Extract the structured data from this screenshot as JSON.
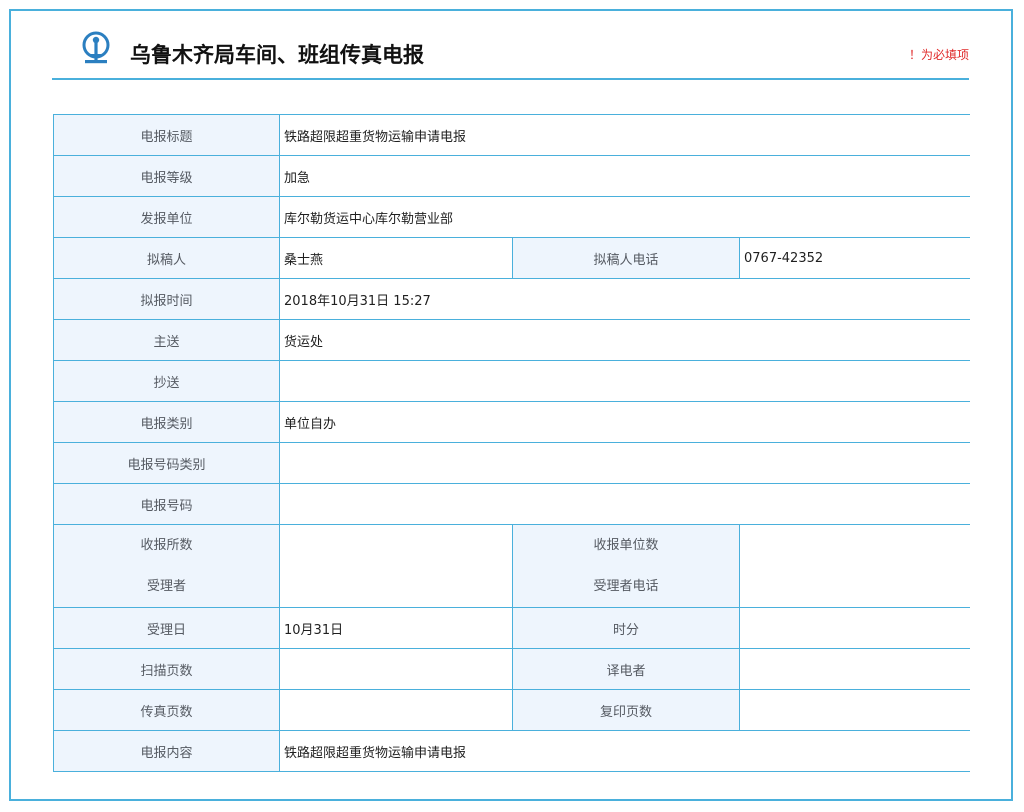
{
  "header": {
    "title": "乌鲁木齐局车间、班组传真电报",
    "required_note": "！为必填项",
    "logo_icon": "railway-logo-icon"
  },
  "colors": {
    "accent": "#4ab0dc",
    "label_bg": "#eef5fd",
    "required": "#e02a2a"
  },
  "form": {
    "title_label": "电报标题",
    "title_value": "铁路超限超重货物运输申请电报",
    "level_label": "电报等级",
    "level_value": "加急",
    "sender_unit_label": "发报单位",
    "sender_unit_value": "库尔勒货运中心库尔勒营业部",
    "drafter_label": "拟稿人",
    "drafter_value": "桑士燕",
    "drafter_phone_label": "拟稿人电话",
    "drafter_phone_value": "0767-42352",
    "draft_time_label": "拟报时间",
    "draft_time_value": "2018年10月31日 15:27",
    "main_to_label": "主送",
    "main_to_value": "货运处",
    "cc_label": "抄送",
    "cc_value": "",
    "category_label": "电报类别",
    "category_value": "单位自办",
    "number_category_label": "电报号码类别",
    "number_category_value": "",
    "number_label": "电报号码",
    "number_value": "",
    "receive_count_label": "收报所数",
    "receive_count_value": "",
    "receive_unit_count_label": "收报单位数",
    "receive_unit_count_value": "",
    "handler_label": "受理者",
    "handler_value": "",
    "handler_phone_label": "受理者电话",
    "handler_phone_value": "",
    "accept_date_label": "受理日",
    "accept_date_value": "10月31日",
    "time_label": "时分",
    "time_value": "",
    "scan_pages_label": "扫描页数",
    "scan_pages_value": "",
    "translator_label": "译电者",
    "translator_value": "",
    "fax_pages_label": "传真页数",
    "fax_pages_value": "",
    "copy_pages_label": "复印页数",
    "copy_pages_value": "",
    "content_label": "电报内容",
    "content_value": "铁路超限超重货物运输申请电报"
  }
}
